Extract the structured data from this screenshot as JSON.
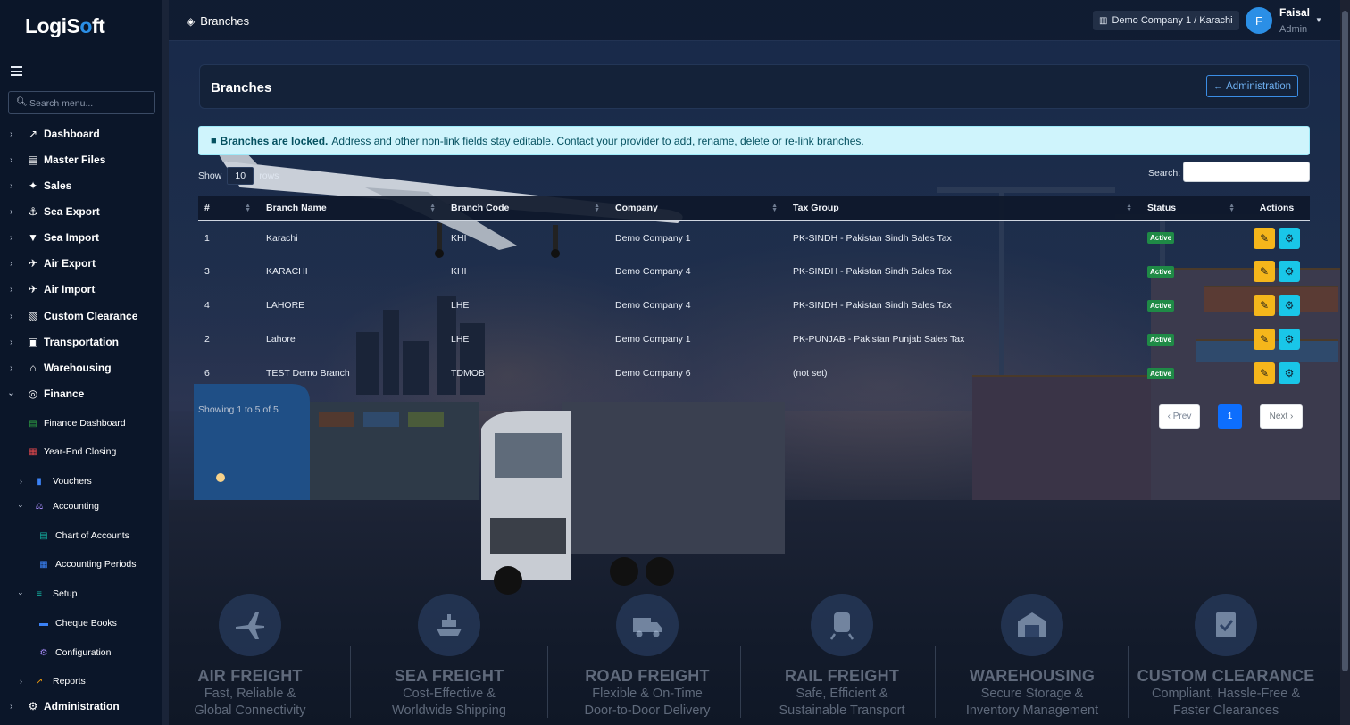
{
  "app": {
    "logo_a": "Logi",
    "logo_b": "S",
    "logo_o": "o",
    "logo_c": "ft"
  },
  "sidebar": {
    "search_placeholder": "Search menu...",
    "items": [
      {
        "label": "Dashboard",
        "icon": "chart-line-icon"
      },
      {
        "label": "Master Files",
        "icon": "database-icon"
      },
      {
        "label": "Sales",
        "icon": "handshake-icon"
      },
      {
        "label": "Sea Export",
        "icon": "anchor-icon"
      },
      {
        "label": "Sea Import",
        "icon": "ship-icon"
      },
      {
        "label": "Air Export",
        "icon": "plane-icon"
      },
      {
        "label": "Air Import",
        "icon": "plane-arrival-icon"
      },
      {
        "label": "Custom Clearance",
        "icon": "file-shield-icon"
      },
      {
        "label": "Transportation",
        "icon": "truck-icon"
      },
      {
        "label": "Warehousing",
        "icon": "warehouse-icon"
      },
      {
        "label": "Finance",
        "icon": "coins-icon"
      }
    ],
    "finance_children": [
      {
        "label": "Finance Dashboard",
        "icon": "money-icon",
        "color": "#2ea043"
      },
      {
        "label": "Year-End Closing",
        "icon": "calendar-x-icon",
        "color": "#e5484d"
      },
      {
        "label": "Vouchers",
        "icon": "file-icon",
        "color": "#3b82f6"
      },
      {
        "label": "Accounting",
        "icon": "scale-icon",
        "color": "#a78bfa"
      },
      {
        "label": "Chart of Accounts",
        "icon": "table-icon",
        "color": "#14b8a6"
      },
      {
        "label": "Accounting Periods",
        "icon": "calendar-icon",
        "color": "#3b82f6"
      },
      {
        "label": "Setup",
        "icon": "sliders-icon",
        "color": "#14b8a6"
      },
      {
        "label": "Cheque Books",
        "icon": "card-icon",
        "color": "#3b82f6"
      },
      {
        "label": "Configuration",
        "icon": "cogs-icon",
        "color": "#a78bfa"
      },
      {
        "label": "Reports",
        "icon": "chart-area-icon",
        "color": "#f59e0b"
      }
    ],
    "admin_label": "Administration"
  },
  "topbar": {
    "title": "Branches",
    "company": "Demo Company 1 / Karachi",
    "avatar_letter": "F",
    "user_name": "Faisal",
    "user_role": "Admin"
  },
  "page": {
    "title": "Branches",
    "back_button": "Administration",
    "alert_bold": "Branches are locked.",
    "alert_text": "Address and other non-link fields stay editable. Contact your provider to add, rename, delete or re-link branches.",
    "show_label": "Show",
    "show_value": "10",
    "rows_label": "rows",
    "search_label": "Search:",
    "search_value": "",
    "columns": [
      "#",
      "Branch Name",
      "Branch Code",
      "Company",
      "Tax Group",
      "Status",
      "Actions"
    ],
    "rows": [
      {
        "num": "1",
        "name": "Karachi",
        "code": "KHI",
        "company": "Demo Company 1",
        "tax": "PK-SINDH - Pakistan Sindh Sales Tax",
        "status": "Active"
      },
      {
        "num": "3",
        "name": "KARACHI",
        "code": "KHI",
        "company": "Demo Company 4",
        "tax": "PK-SINDH - Pakistan Sindh Sales Tax",
        "status": "Active"
      },
      {
        "num": "4",
        "name": "LAHORE",
        "code": "LHE",
        "company": "Demo Company 4",
        "tax": "PK-SINDH - Pakistan Sindh Sales Tax",
        "status": "Active"
      },
      {
        "num": "2",
        "name": "Lahore",
        "code": "LHE",
        "company": "Demo Company 1",
        "tax": "PK-PUNJAB - Pakistan Punjab Sales Tax",
        "status": "Active"
      },
      {
        "num": "6",
        "name": "TEST Demo Branch",
        "code": "TDMOB",
        "company": "Demo Company 6",
        "tax": "(not set)",
        "status": "Active"
      }
    ],
    "showing": "Showing 1 to 5 of 5",
    "prev": "‹ Prev",
    "current_page": "1",
    "next": "Next ›"
  },
  "services": [
    {
      "title": "AIR FREIGHT",
      "line1": "Fast, Reliable &",
      "line2": "Global Connectivity",
      "icon": "plane-icon"
    },
    {
      "title": "SEA FREIGHT",
      "line1": "Cost-Effective &",
      "line2": "Worldwide Shipping",
      "icon": "ship-icon"
    },
    {
      "title": "ROAD FREIGHT",
      "line1": "Flexible & On-Time",
      "line2": "Door-to-Door Delivery",
      "icon": "truck-icon"
    },
    {
      "title": "RAIL FREIGHT",
      "line1": "Safe, Efficient &",
      "line2": "Sustainable Transport",
      "icon": "train-icon"
    },
    {
      "title": "WAREHOUSING",
      "line1": "Secure Storage &",
      "line2": "Inventory Management",
      "icon": "warehouse-icon"
    },
    {
      "title": "CUSTOM CLEARANCE",
      "line1": "Compliant, Hassle-Free &",
      "line2": "Faster Clearances",
      "icon": "clipboard-check-icon"
    }
  ],
  "colors": {
    "accent": "#2b8fe6",
    "badge": "#1f8a46",
    "edit": "#f5b61b",
    "settings": "#19c6e8",
    "alert_bg": "#cff4fc"
  }
}
